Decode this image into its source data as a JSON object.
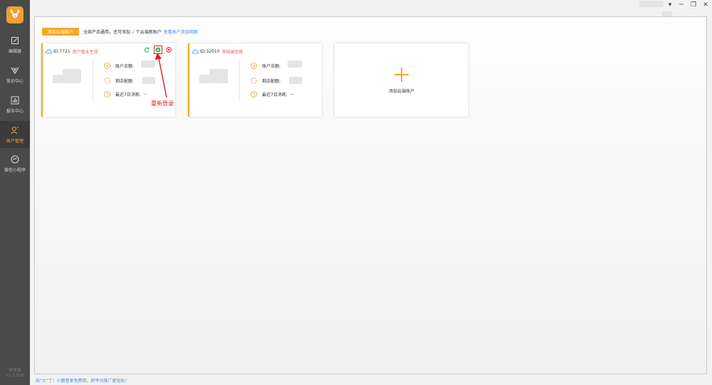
{
  "sidebar": {
    "items": [
      {
        "label": "编辑器",
        "icon": "edit-icon"
      },
      {
        "label": "竞价中心",
        "icon": "bidding-icon"
      },
      {
        "label": "报告中心",
        "icon": "report-icon"
      },
      {
        "label": "账户管理",
        "icon": "account-icon",
        "active": true
      },
      {
        "label": "微信小程序",
        "icon": "mini-program-icon"
      }
    ],
    "version_name": "尊享版",
    "version": "v1.3.826"
  },
  "window": {
    "minimize": "─",
    "restore": "❐",
    "close": "✕",
    "menu": "▾"
  },
  "toolbar": {
    "add_button": "添加云端账户",
    "hint_prefix": "全部产品通用，还可添加",
    "hint_count": "2",
    "hint_suffix": "个云端新账户",
    "guide_link": "查看账户添加明细"
  },
  "accounts": [
    {
      "id_label": "ID:7721",
      "status": "用户暂未生效",
      "balance_label": "账户余额:",
      "quota_label": "剩余配额:",
      "cost_label": "最近7日消耗:",
      "cost_value": "--"
    },
    {
      "id_label": "ID:32010",
      "status": "审核被拒绝",
      "balance_label": "账户余额:",
      "quota_label": "剩余配额:",
      "cost_label": "最近7日消耗:",
      "cost_value": "--"
    }
  ],
  "add_card": {
    "label": "添加云端账户"
  },
  "annotation": {
    "label": "重新登录"
  },
  "footer": {
    "text": "玩\"大\"了！小鹿管家免费用，跨平台推广更轻松！"
  },
  "colors": {
    "accent": "#f7a823",
    "sidebar": "#4a4a4a",
    "link": "#4a8ee6",
    "status_error": "#f06060",
    "annotation": "#e02020"
  }
}
